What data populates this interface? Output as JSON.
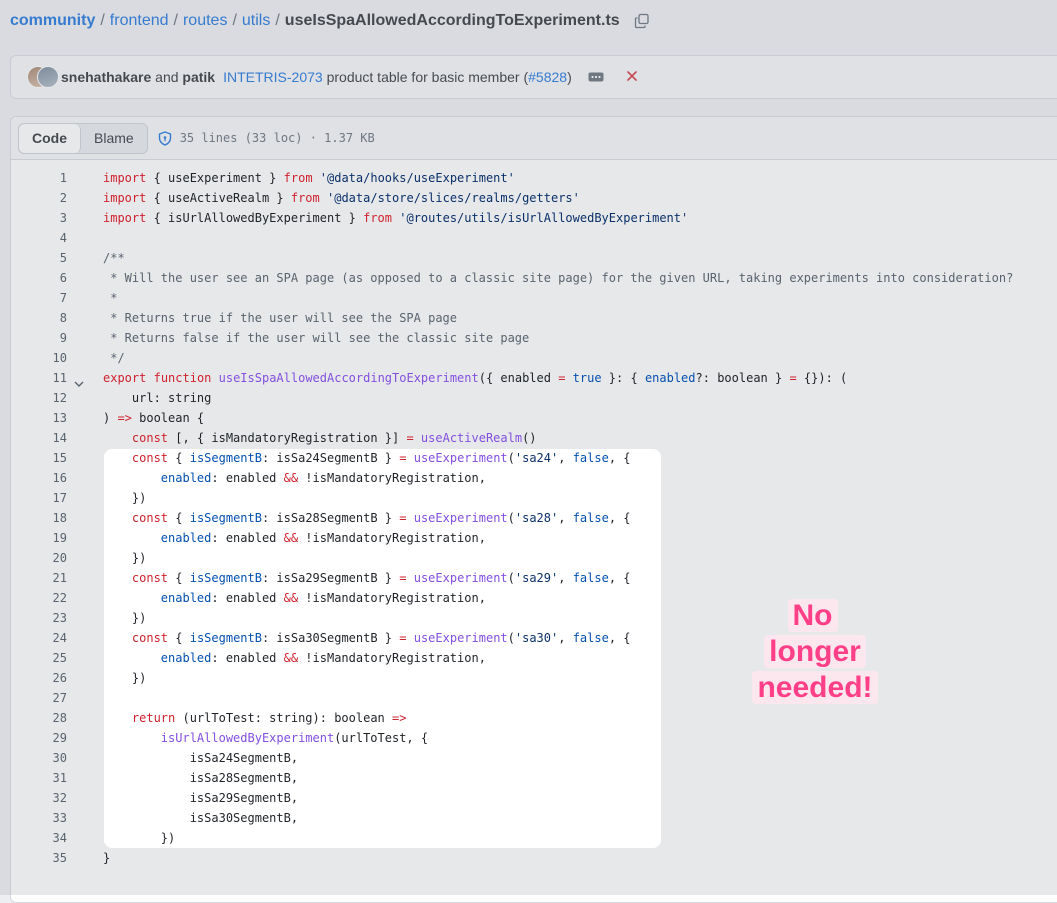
{
  "breadcrumb": {
    "segments": [
      "community",
      "frontend",
      "routes",
      "utils"
    ],
    "separator": "/",
    "file": "useIsSpaAllowedAccordingToExperiment.ts"
  },
  "commit": {
    "author1": "snehathakare",
    "and": "and",
    "author2": "patik",
    "ticket": "INTETRIS-2073",
    "message": "product table for basic member",
    "pr_open": "(",
    "pr": "#5828",
    "pr_close": ")",
    "status_color": "#d1242f"
  },
  "file_header": {
    "tabs": [
      "Code",
      "Blame"
    ],
    "meta": "35 lines (33 loc) · 1.37 KB"
  },
  "code_lines": [
    [
      [
        "kw",
        "import"
      ],
      [
        "t",
        " { useExperiment } "
      ],
      [
        "kw",
        "from"
      ],
      [
        "t",
        " "
      ],
      [
        "str",
        "'@data/hooks/useExperiment'"
      ]
    ],
    [
      [
        "kw",
        "import"
      ],
      [
        "t",
        " { useActiveRealm } "
      ],
      [
        "kw",
        "from"
      ],
      [
        "t",
        " "
      ],
      [
        "str",
        "'@data/store/slices/realms/getters'"
      ]
    ],
    [
      [
        "kw",
        "import"
      ],
      [
        "t",
        " { isUrlAllowedByExperiment } "
      ],
      [
        "kw",
        "from"
      ],
      [
        "t",
        " "
      ],
      [
        "str",
        "'@routes/utils/isUrlAllowedByExperiment'"
      ]
    ],
    [],
    [
      [
        "cm",
        "/**"
      ]
    ],
    [
      [
        "cm",
        " * Will the user see an SPA page (as opposed to a classic site page) for the given URL, taking experiments into consideration?"
      ]
    ],
    [
      [
        "cm",
        " *"
      ]
    ],
    [
      [
        "cm",
        " * Returns true if the user will see the SPA page"
      ]
    ],
    [
      [
        "cm",
        " * Returns false if the user will see the classic site page"
      ]
    ],
    [
      [
        "cm",
        " */"
      ]
    ],
    [
      [
        "kw",
        "export"
      ],
      [
        "t",
        " "
      ],
      [
        "kw",
        "function"
      ],
      [
        "t",
        " "
      ],
      [
        "fn",
        "useIsSpaAllowedAccordingToExperiment"
      ],
      [
        "t",
        "({ enabled "
      ],
      [
        "kw",
        "="
      ],
      [
        "t",
        " "
      ],
      [
        "pr",
        "true"
      ],
      [
        "t",
        " }: { "
      ],
      [
        "pr",
        "enabled"
      ],
      [
        "t",
        "?: boolean } "
      ],
      [
        "kw",
        "="
      ],
      [
        "t",
        " {}): ("
      ]
    ],
    [
      [
        "t",
        "    url: string"
      ]
    ],
    [
      [
        "t",
        ") "
      ],
      [
        "kw",
        "=>"
      ],
      [
        "t",
        " boolean {"
      ]
    ],
    [
      [
        "t",
        "    "
      ],
      [
        "kw",
        "const"
      ],
      [
        "t",
        " [, { isMandatoryRegistration }] "
      ],
      [
        "kw",
        "="
      ],
      [
        "t",
        " "
      ],
      [
        "fn",
        "useActiveRealm"
      ],
      [
        "t",
        "()"
      ]
    ],
    [
      [
        "t",
        "    "
      ],
      [
        "kw",
        "const"
      ],
      [
        "t",
        " { "
      ],
      [
        "pr",
        "isSegmentB"
      ],
      [
        "t",
        ": isSa24SegmentB } "
      ],
      [
        "kw",
        "="
      ],
      [
        "t",
        " "
      ],
      [
        "fn",
        "useExperiment"
      ],
      [
        "t",
        "("
      ],
      [
        "str",
        "'sa24'"
      ],
      [
        "t",
        ", "
      ],
      [
        "pr",
        "false"
      ],
      [
        "t",
        ", {"
      ]
    ],
    [
      [
        "t",
        "        "
      ],
      [
        "pr",
        "enabled"
      ],
      [
        "t",
        ": enabled "
      ],
      [
        "kw",
        "&&"
      ],
      [
        "t",
        " !isMandatoryRegistration,"
      ]
    ],
    [
      [
        "t",
        "    })"
      ]
    ],
    [
      [
        "t",
        "    "
      ],
      [
        "kw",
        "const"
      ],
      [
        "t",
        " { "
      ],
      [
        "pr",
        "isSegmentB"
      ],
      [
        "t",
        ": isSa28SegmentB } "
      ],
      [
        "kw",
        "="
      ],
      [
        "t",
        " "
      ],
      [
        "fn",
        "useExperiment"
      ],
      [
        "t",
        "("
      ],
      [
        "str",
        "'sa28'"
      ],
      [
        "t",
        ", "
      ],
      [
        "pr",
        "false"
      ],
      [
        "t",
        ", {"
      ]
    ],
    [
      [
        "t",
        "        "
      ],
      [
        "pr",
        "enabled"
      ],
      [
        "t",
        ": enabled "
      ],
      [
        "kw",
        "&&"
      ],
      [
        "t",
        " !isMandatoryRegistration,"
      ]
    ],
    [
      [
        "t",
        "    })"
      ]
    ],
    [
      [
        "t",
        "    "
      ],
      [
        "kw",
        "const"
      ],
      [
        "t",
        " { "
      ],
      [
        "pr",
        "isSegmentB"
      ],
      [
        "t",
        ": isSa29SegmentB } "
      ],
      [
        "kw",
        "="
      ],
      [
        "t",
        " "
      ],
      [
        "fn",
        "useExperiment"
      ],
      [
        "t",
        "("
      ],
      [
        "str",
        "'sa29'"
      ],
      [
        "t",
        ", "
      ],
      [
        "pr",
        "false"
      ],
      [
        "t",
        ", {"
      ]
    ],
    [
      [
        "t",
        "        "
      ],
      [
        "pr",
        "enabled"
      ],
      [
        "t",
        ": enabled "
      ],
      [
        "kw",
        "&&"
      ],
      [
        "t",
        " !isMandatoryRegistration,"
      ]
    ],
    [
      [
        "t",
        "    })"
      ]
    ],
    [
      [
        "t",
        "    "
      ],
      [
        "kw",
        "const"
      ],
      [
        "t",
        " { "
      ],
      [
        "pr",
        "isSegmentB"
      ],
      [
        "t",
        ": isSa30SegmentB } "
      ],
      [
        "kw",
        "="
      ],
      [
        "t",
        " "
      ],
      [
        "fn",
        "useExperiment"
      ],
      [
        "t",
        "("
      ],
      [
        "str",
        "'sa30'"
      ],
      [
        "t",
        ", "
      ],
      [
        "pr",
        "false"
      ],
      [
        "t",
        ", {"
      ]
    ],
    [
      [
        "t",
        "        "
      ],
      [
        "pr",
        "enabled"
      ],
      [
        "t",
        ": enabled "
      ],
      [
        "kw",
        "&&"
      ],
      [
        "t",
        " !isMandatoryRegistration,"
      ]
    ],
    [
      [
        "t",
        "    })"
      ]
    ],
    [],
    [
      [
        "t",
        "    "
      ],
      [
        "kw",
        "return"
      ],
      [
        "t",
        " (urlToTest: string): boolean "
      ],
      [
        "kw",
        "=>"
      ]
    ],
    [
      [
        "t",
        "        "
      ],
      [
        "fn",
        "isUrlAllowedByExperiment"
      ],
      [
        "t",
        "(urlToTest, {"
      ]
    ],
    [
      [
        "t",
        "            isSa24SegmentB,"
      ]
    ],
    [
      [
        "t",
        "            isSa28SegmentB,"
      ]
    ],
    [
      [
        "t",
        "            isSa29SegmentB,"
      ]
    ],
    [
      [
        "t",
        "            isSa30SegmentB,"
      ]
    ],
    [
      [
        "t",
        "        })"
      ]
    ],
    [
      [
        "t",
        "}"
      ]
    ]
  ],
  "fold_line": 11,
  "highlight_range": [
    15,
    34
  ],
  "annotation": {
    "line1": "No longer",
    "line2": "needed!",
    "color": "#ff3f87"
  }
}
